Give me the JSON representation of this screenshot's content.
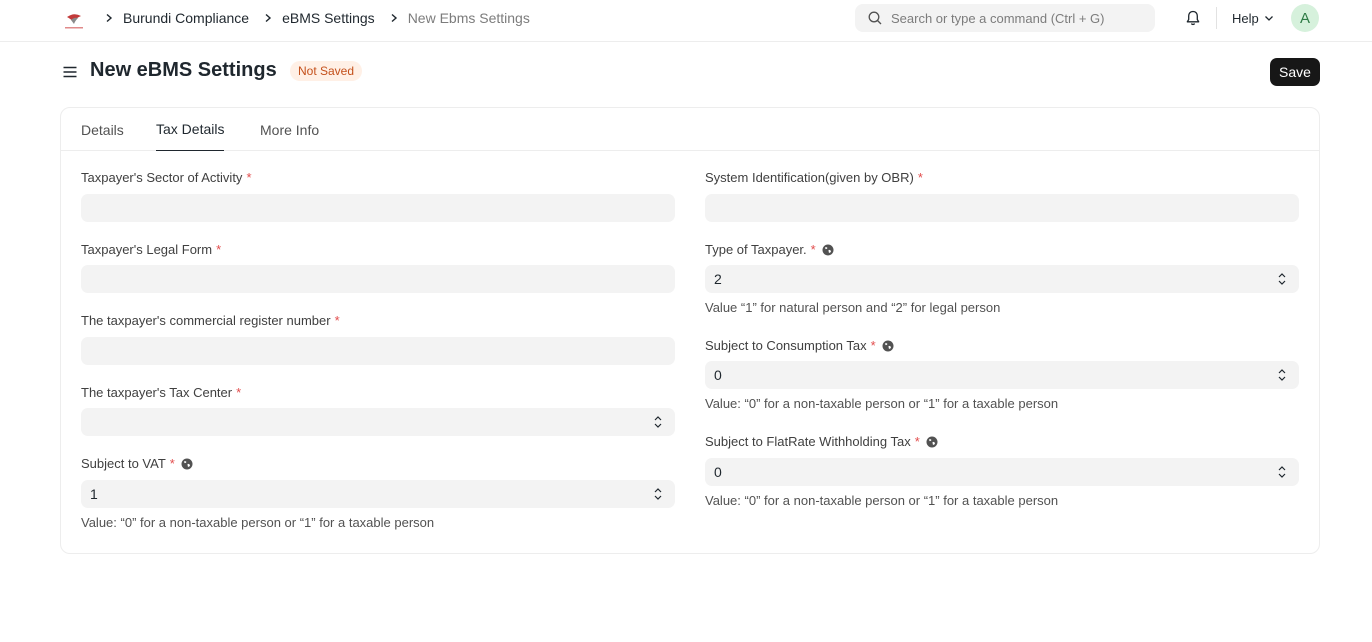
{
  "navbar": {
    "breadcrumbs": [
      "Burundi Compliance",
      "eBMS Settings",
      "New Ebms Settings"
    ],
    "search_placeholder": "Search or type a command (Ctrl + G)",
    "help_label": "Help",
    "avatar_initial": "A"
  },
  "page": {
    "title": "New eBMS Settings",
    "status": "Not Saved",
    "save_label": "Save"
  },
  "tabs": [
    "Details",
    "Tax Details",
    "More Info"
  ],
  "active_tab": "Tax Details",
  "form": {
    "left": [
      {
        "label": "Taxpayer's Sector of Activity",
        "required": "*",
        "value": "",
        "type": "text"
      },
      {
        "label": "Taxpayer's Legal Form",
        "required": "*",
        "value": "",
        "type": "text"
      },
      {
        "label": "The taxpayer's commercial register number",
        "required": "*",
        "value": "",
        "type": "text"
      },
      {
        "label": "The taxpayer's Tax Center",
        "required": "*",
        "value": "",
        "type": "select"
      },
      {
        "label": "Subject to VAT",
        "required": "*",
        "value": "1",
        "type": "select",
        "help": "Value: “0” for a non-taxable person or “1” for a taxable person"
      }
    ],
    "right": [
      {
        "label": "System Identification(given by OBR)",
        "required": "*",
        "value": "",
        "type": "text"
      },
      {
        "label": "Type of Taxpayer.",
        "required": "*",
        "value": "2",
        "type": "select",
        "help": "Value “1” for natural person and “2” for legal person"
      },
      {
        "label": "Subject to Consumption Tax",
        "required": "*",
        "value": "0",
        "type": "select",
        "help": "Value: “0” for a non-taxable person or “1” for a taxable person"
      },
      {
        "label": "Subject to FlatRate Withholding Tax",
        "required": "*",
        "value": "0",
        "type": "select",
        "help": "Value: “0” for a non-taxable person or “1” for a taxable person"
      }
    ]
  },
  "colors": {
    "accent": "#171717",
    "status_bg": "#fff0e6",
    "status_text": "#c4501b",
    "required": "#e24c4c",
    "control_bg": "#f3f3f3"
  },
  "icons": [
    "app-logo-icon",
    "chevron-right-icon",
    "search-icon",
    "bell-icon",
    "chevron-down-icon",
    "hamburger-icon",
    "globe-icon",
    "select-arrows-icon"
  ]
}
